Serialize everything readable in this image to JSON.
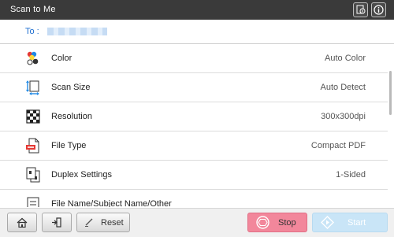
{
  "header": {
    "title": "Scan to Me",
    "icons": [
      "user-info-icon",
      "info-icon"
    ]
  },
  "destination": {
    "label": "To :",
    "value_redacted": true
  },
  "settings": [
    {
      "icon": "color-icon",
      "label": "Color",
      "value": "Auto Color"
    },
    {
      "icon": "scan-size-icon",
      "label": "Scan Size",
      "value": "Auto Detect"
    },
    {
      "icon": "resolution-icon",
      "label": "Resolution",
      "value": "300x300dpi"
    },
    {
      "icon": "file-type-pdf-icon",
      "label": "File Type",
      "value": "Compact PDF"
    },
    {
      "icon": "duplex-icon",
      "label": "Duplex Settings",
      "value": "1-Sided"
    },
    {
      "icon": "file-name-icon",
      "label": "File Name/Subject Name/Other",
      "value": ""
    }
  ],
  "footer": {
    "reset_label": "Reset",
    "stop_label": "Stop",
    "start_label": "Start",
    "start_enabled": false
  },
  "colors": {
    "title_bar": "#3a3a3a",
    "accent_blue": "#1f6fd0",
    "stop": "#f2879b",
    "start_disabled": "#c9e5f7"
  }
}
